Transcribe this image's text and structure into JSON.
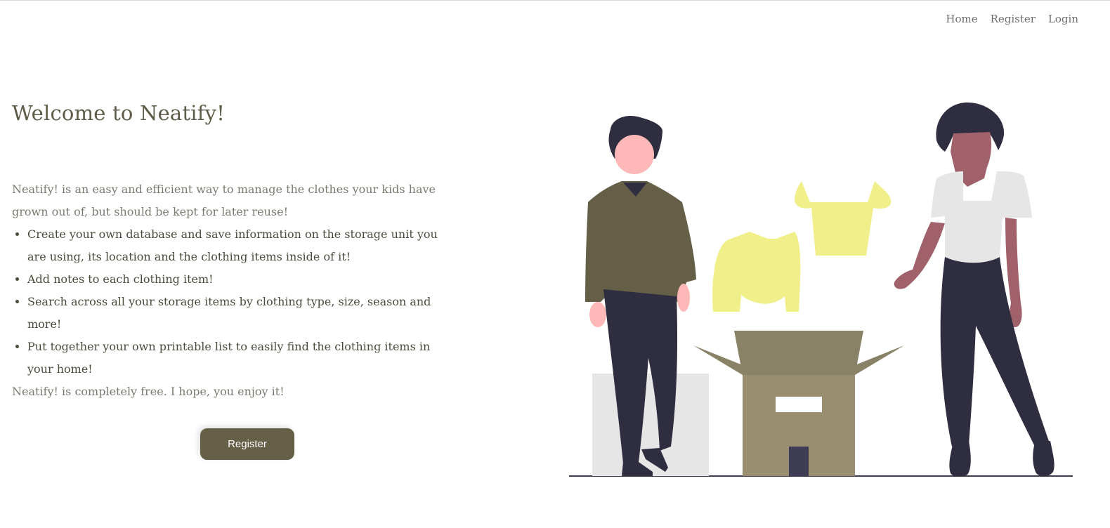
{
  "nav": {
    "items": [
      "Home",
      "Register",
      "Login"
    ]
  },
  "hero": {
    "title": "Welcome to Neatify!",
    "intro": "Neatify! is an easy and efficient way to manage the clothes your kids have grown out of, but should be kept for later reuse!",
    "features": [
      "Create your own database and save information on the storage unit you are using, its location and the clothing items inside of it!",
      "Add notes to each clothing item!",
      "Search across all your storage items by clothing type, size, season and more!",
      "Put together your own printable list to easily find the clothing items in your home!"
    ],
    "outro": "Neatify! is completely free. I hope, you enjoy it!",
    "register_label": "Register"
  },
  "colors": {
    "accent": "#665f48",
    "box": "#998f70",
    "clothing": "#f0ef8a",
    "dark": "#2f2e41"
  }
}
